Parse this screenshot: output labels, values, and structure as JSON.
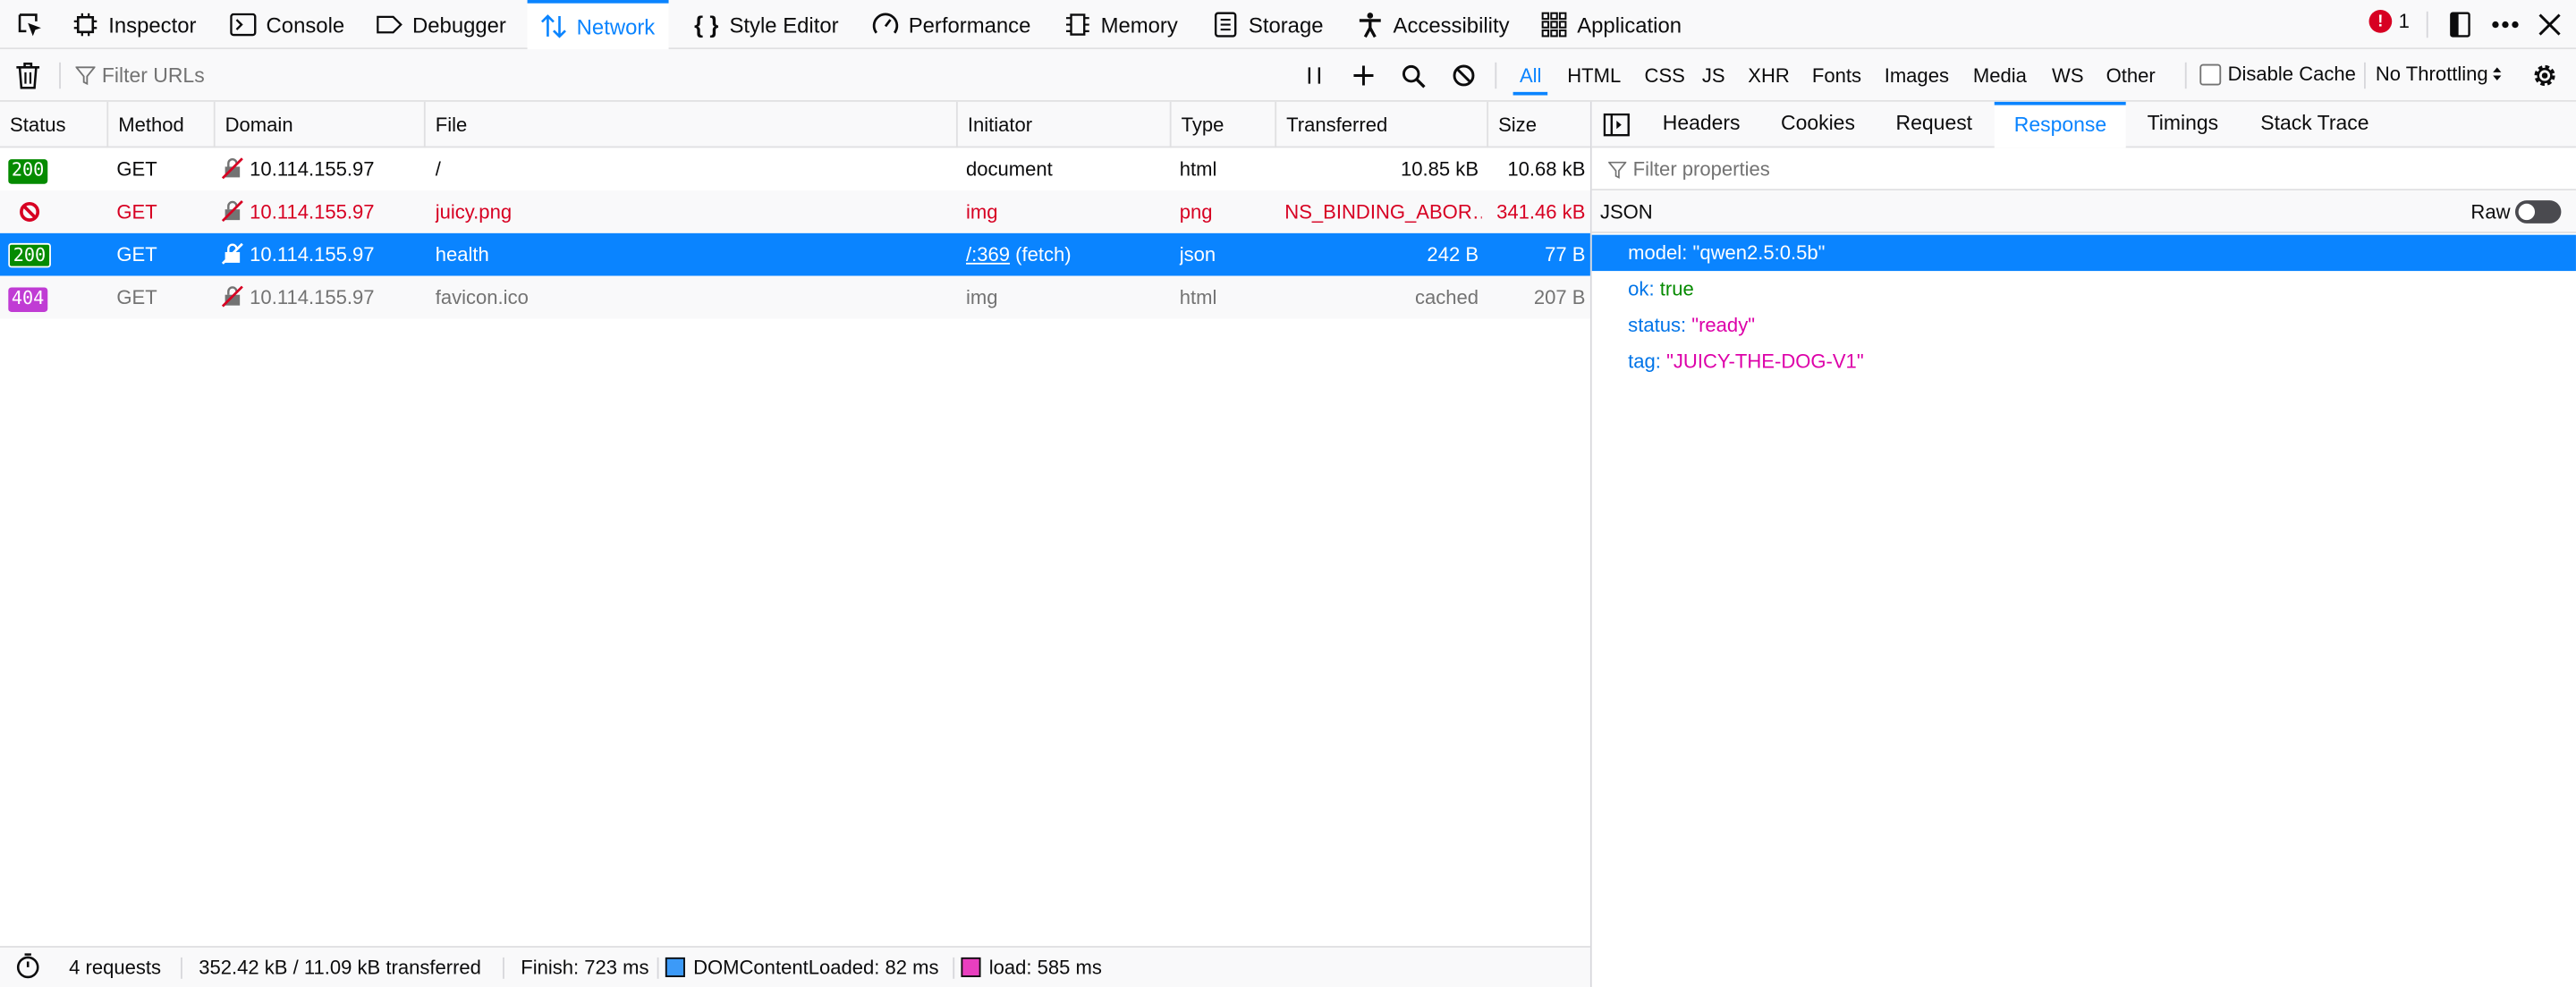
{
  "toolbar": {
    "tabs": [
      {
        "label": "Inspector",
        "icon": "inspector-icon"
      },
      {
        "label": "Console",
        "icon": "console-icon"
      },
      {
        "label": "Debugger",
        "icon": "debugger-icon"
      },
      {
        "label": "Network",
        "icon": "network-icon",
        "active": true
      },
      {
        "label": "Style Editor",
        "icon": "style-editor-icon"
      },
      {
        "label": "Performance",
        "icon": "performance-icon"
      },
      {
        "label": "Memory",
        "icon": "memory-icon"
      },
      {
        "label": "Storage",
        "icon": "storage-icon"
      },
      {
        "label": "Accessibility",
        "icon": "accessibility-icon"
      },
      {
        "label": "Application",
        "icon": "application-icon"
      }
    ],
    "error_count": "1",
    "accent_color": "#0a84ff"
  },
  "filterbar": {
    "placeholder": "Filter URLs",
    "types": [
      "All",
      "HTML",
      "CSS",
      "JS",
      "XHR",
      "Fonts",
      "Images",
      "Media",
      "WS",
      "Other"
    ],
    "active_type": "All",
    "disable_cache_label": "Disable Cache",
    "throttling": "No Throttling"
  },
  "table": {
    "columns": [
      "Status",
      "Method",
      "Domain",
      "File",
      "Initiator",
      "Type",
      "Transferred",
      "Size"
    ],
    "rows": [
      {
        "status": "200",
        "method": "GET",
        "domain": "10.114.155.97",
        "file": "/",
        "initiator": "document",
        "initiator_suffix": "",
        "type": "html",
        "transferred": "10.85 kB",
        "size": "10.68 kB"
      },
      {
        "status": "",
        "method": "GET",
        "domain": "10.114.155.97",
        "file": "juicy.png",
        "initiator": "img",
        "initiator_suffix": "",
        "type": "png",
        "transferred": "NS_BINDING_ABOR…",
        "size": "341.46 kB"
      },
      {
        "status": "200",
        "method": "GET",
        "domain": "10.114.155.97",
        "file": "health",
        "initiator": "/:369",
        "initiator_suffix": " (fetch)",
        "type": "json",
        "transferred": "242 B",
        "size": "77 B"
      },
      {
        "status": "404",
        "method": "GET",
        "domain": "10.114.155.97",
        "file": "favicon.ico",
        "initiator": "img",
        "initiator_suffix": "",
        "type": "html",
        "transferred": "cached",
        "size": "207 B"
      }
    ]
  },
  "footer": {
    "requests": "4 requests",
    "transferred": "352.42 kB / 11.09 kB transferred",
    "finish": "Finish: 723 ms",
    "dom_content_loaded": "DOMContentLoaded: 82 ms",
    "load": "load: 585 ms",
    "dom_color": "#3c9af8",
    "load_color": "#e93fbf"
  },
  "panel": {
    "tabs": [
      "Headers",
      "Cookies",
      "Request",
      "Response",
      "Timings",
      "Stack Trace"
    ],
    "active_tab": "Response",
    "filter_placeholder": "Filter properties",
    "json_label": "JSON",
    "raw_label": "Raw",
    "json": [
      {
        "key": "model:",
        "value": "\"qwen2.5:0.5b\"",
        "kind": "string"
      },
      {
        "key": "ok:",
        "value": "true",
        "kind": "bool"
      },
      {
        "key": "status:",
        "value": "\"ready\"",
        "kind": "string"
      },
      {
        "key": "tag:",
        "value": "\"JUICY-THE-DOG-V1\"",
        "kind": "string"
      }
    ]
  }
}
